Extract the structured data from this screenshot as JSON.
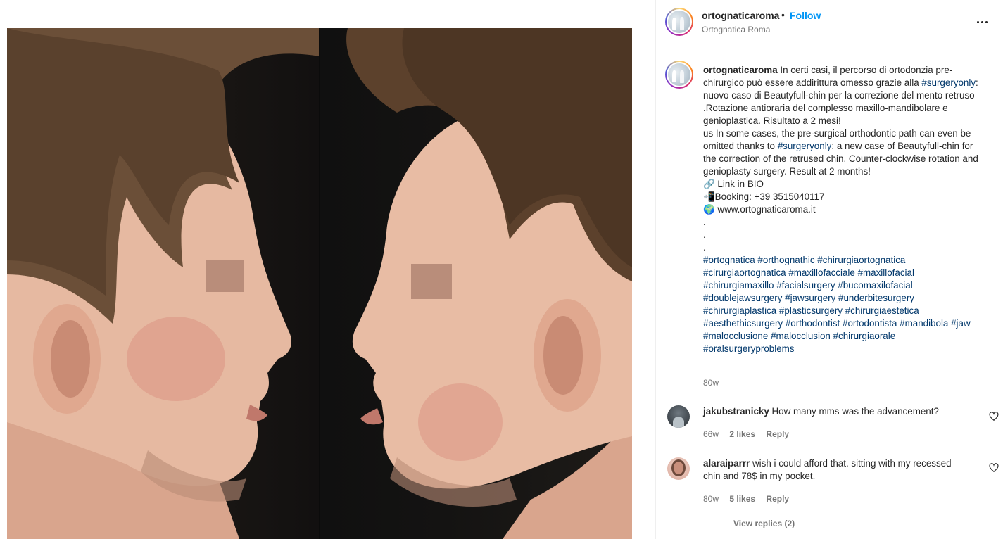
{
  "post": {
    "username": "ortognaticaroma",
    "follow_label": "Follow",
    "separator": "•",
    "location": "Ortognatica Roma",
    "more_icon": "more-horizontal-icon"
  },
  "caption": {
    "username": "ortognaticaroma",
    "lines": [
      {
        "pre": " In certi casi, il percorso di ortodonzia pre-",
        "tag": "",
        "post": ""
      },
      {
        "pre": "chirurgico può essere addirittura omesso grazie alla ",
        "tag": "#surgeryonly",
        "post": ":"
      },
      {
        "pre": "nuovo caso di Beautyfull-chin per la correzione del mento retruso",
        "tag": "",
        "post": ""
      },
      {
        "pre": ".Rotazione antioraria del complesso maxillo-mandibolare e",
        "tag": "",
        "post": ""
      },
      {
        "pre": "genioplastica. Risultato a 2 mesi!",
        "tag": "",
        "post": ""
      },
      {
        "pre": "us In some cases, the pre-surgical orthodontic path can even be",
        "tag": "",
        "post": ""
      },
      {
        "pre": "omitted thanks to ",
        "tag": "#surgeryonly",
        "post": ": a new case of Beautyfull-chin for"
      },
      {
        "pre": "the correction of the retrused chin. Counter-clockwise rotation and",
        "tag": "",
        "post": ""
      },
      {
        "pre": "genioplasty surgery. Result at 2 months!",
        "tag": "",
        "post": ""
      },
      {
        "pre": " ",
        "tag": "",
        "post": ""
      },
      {
        "pre": "🔗 Link in BIO",
        "tag": "",
        "post": ""
      },
      {
        "pre": "📲Booking: +39 3515040117",
        "tag": "",
        "post": ""
      },
      {
        "pre": "🌍 www.ortognaticaroma.it",
        "tag": "",
        "post": ""
      },
      {
        "pre": ".",
        "tag": "",
        "post": ""
      },
      {
        "pre": ".",
        "tag": "",
        "post": ""
      },
      {
        "pre": ".",
        "tag": "",
        "post": ""
      }
    ],
    "hashtag_lines": [
      "#ortognatica #orthognathic #chirurgiaortognatica",
      "#cirurgiaortognatica #maxillofacciale #maxillofacial",
      "#chirurgiamaxillo #facialsurgery #bucomaxilofacial",
      "#doublejawsurgery #jawsurgery #underbitesurgery",
      "#chirurgiaplastica #plasticsurgery #chirurgiaestetica",
      "#aesthethicsurgery #orthodontist #ortodontista #mandibola #jaw",
      "#malocclusione #malocclusion #chirurgiaorale",
      "#oralsurgeryproblems"
    ],
    "time": "80w"
  },
  "comments": [
    {
      "username": "jakubstranicky",
      "lines": [
        " How many mms was the advancement?"
      ],
      "time": "66w",
      "likes": "2 likes",
      "reply_label": "Reply"
    },
    {
      "username": "alaraiparrr",
      "lines": [
        " wish i could afford that. sitting with my recessed",
        "chin and 78$ in my pocket."
      ],
      "time": "80w",
      "likes": "5 likes",
      "reply_label": "Reply"
    }
  ],
  "view_replies_label": "View replies (2)",
  "colors": {
    "accent": "#0095f6",
    "hashtag": "#00376b",
    "muted": "#737373",
    "text": "#262626"
  }
}
